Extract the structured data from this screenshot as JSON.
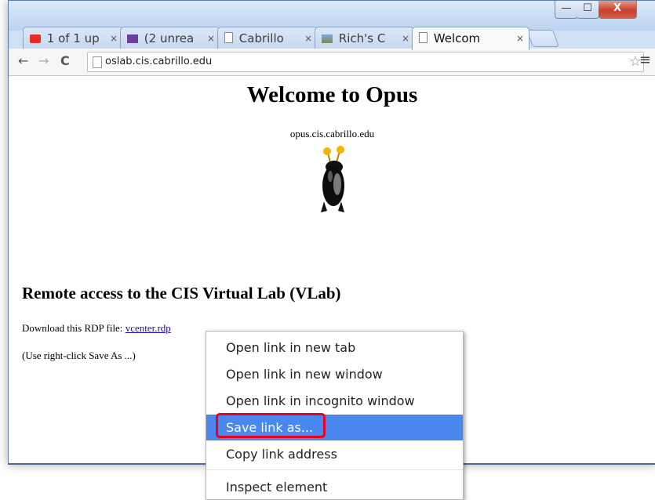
{
  "window": {
    "min_label": "—",
    "max_label": "☐",
    "close_label": "X"
  },
  "tabs": [
    {
      "title": "1 of 1 up",
      "icon": "youtube-icon",
      "color": "#e52d27"
    },
    {
      "title": "(2 unrea",
      "icon": "mail-icon",
      "color": "#6b3fa0"
    },
    {
      "title": "Cabrillo",
      "icon": "page-icon"
    },
    {
      "title": "Rich's C",
      "icon": "landscape-icon"
    },
    {
      "title": "Welcom",
      "icon": "page-icon",
      "active": true
    }
  ],
  "tab_close_label": "×",
  "toolbar": {
    "back": "←",
    "forward": "→",
    "reload": "C",
    "url": "oslab.cis.cabrillo.edu",
    "star": "☆",
    "menu": "≡"
  },
  "page": {
    "title": "Welcome to Opus",
    "host": "opus.cis.cabrillo.edu",
    "section_title": "Remote access to the CIS Virtual Lab (VLab)",
    "download_prefix": "Download this RDP file:",
    "download_link": "vcenter.rdp",
    "hint": "(Use right-click Save As ...)"
  },
  "context_menu": {
    "items": [
      "Open link in new tab",
      "Open link in new window",
      "Open link in incognito window",
      "Save link as...",
      "Copy link address",
      "Inspect element"
    ],
    "highlighted": "Save link as..."
  },
  "colors": {
    "highlight": "#4a87ee",
    "callout": "#e8001c",
    "link": "#1a0dab"
  }
}
